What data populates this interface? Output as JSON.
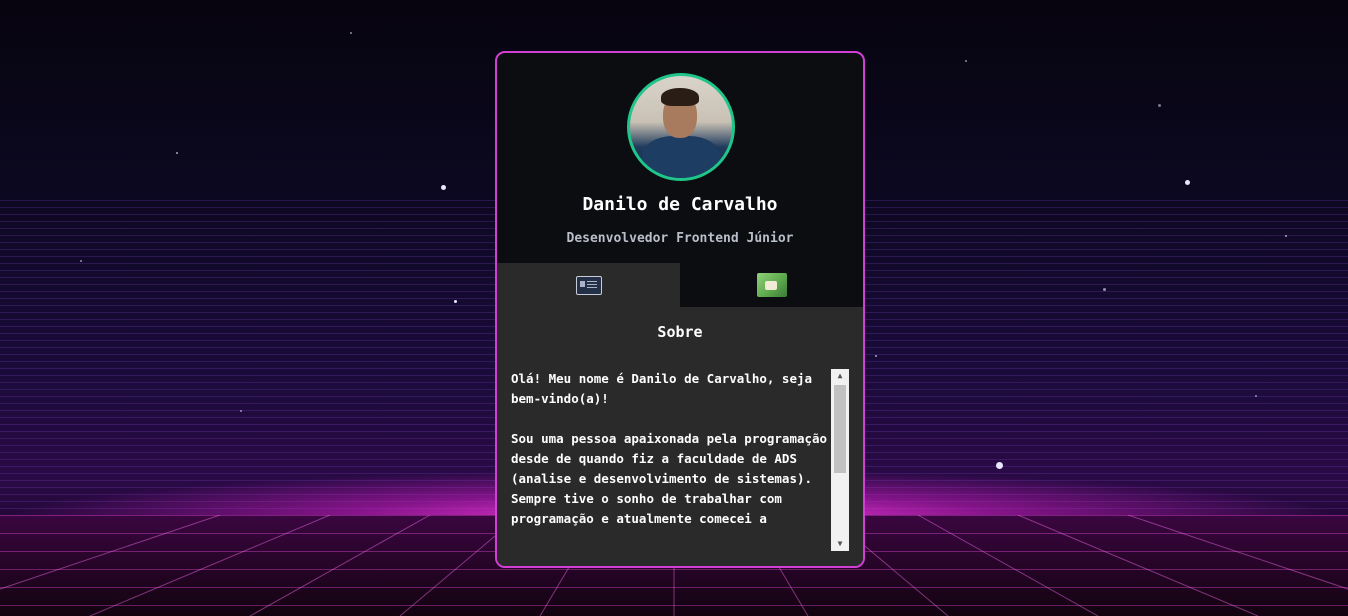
{
  "profile": {
    "name": "Danilo de Carvalho",
    "role": "Desenvolvedor Frontend Júnior",
    "avatar_icon": "profile-photo"
  },
  "tabs": [
    {
      "id": "about",
      "icon": "about-card-icon",
      "active": true
    },
    {
      "id": "projects",
      "icon": "projects-image-icon",
      "active": false
    }
  ],
  "about": {
    "title": "Sobre",
    "text": "Olá! Meu nome é Danilo de Carvalho, seja bem-vindo(a)!\n\nSou uma pessoa apaixonada pela programação desde de quando fiz a faculdade de ADS (analise e desenvolvimento de sistemas). Sempre tive o sonho de trabalhar com programação e atualmente comecei a"
  },
  "scrollbar": {
    "up": "▲",
    "down": "▼"
  },
  "colors": {
    "card_border": "#d13fd4",
    "avatar_border": "#20c58a",
    "panel_bg": "#2a2a2a",
    "card_bg": "#0b0d10"
  }
}
